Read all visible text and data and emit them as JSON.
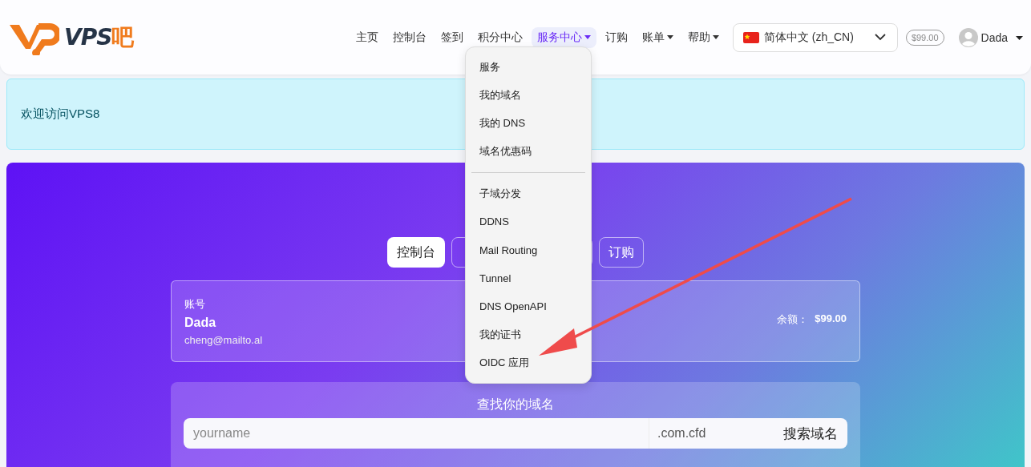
{
  "logo": {
    "text": "VPS",
    "accent": "吧"
  },
  "nav": [
    {
      "label": "主页",
      "selected": false,
      "dropdown": false
    },
    {
      "label": "控制台",
      "selected": false,
      "dropdown": false
    },
    {
      "label": "签到",
      "selected": false,
      "dropdown": false
    },
    {
      "label": "积分中心",
      "selected": false,
      "dropdown": false
    },
    {
      "label": "服务中心",
      "selected": true,
      "dropdown": true
    },
    {
      "label": "订购",
      "selected": false,
      "dropdown": false
    },
    {
      "label": "账单",
      "selected": false,
      "dropdown": true
    },
    {
      "label": "帮助",
      "selected": false,
      "dropdown": true
    }
  ],
  "language": {
    "value": "简体中文 (zh_CN)"
  },
  "balance_badge": "$99.00",
  "user": {
    "name": "Dada"
  },
  "alert": "欢迎访问VPS8",
  "dropdown_menu": [
    {
      "label": "服务",
      "kind": "item"
    },
    {
      "label": "我的域名",
      "kind": "item"
    },
    {
      "label": "我的 DNS",
      "kind": "item"
    },
    {
      "label": "域名优惠码",
      "kind": "item"
    },
    {
      "kind": "divider"
    },
    {
      "label": "子域分发",
      "kind": "item"
    },
    {
      "label": "DDNS",
      "kind": "item"
    },
    {
      "label": "Mail Routing",
      "kind": "item"
    },
    {
      "label": "Tunnel",
      "kind": "item"
    },
    {
      "label": "DNS OpenAPI",
      "kind": "item"
    },
    {
      "label": "我的证书",
      "kind": "item"
    },
    {
      "label": "OIDC 应用",
      "kind": "item"
    }
  ],
  "hero_tabs": [
    {
      "label": "控制台",
      "selected": true
    },
    {
      "selected": false
    },
    {
      "selected": false
    },
    {
      "label": "订购",
      "selected": false
    }
  ],
  "account": {
    "heading": "账号",
    "name": "Dada",
    "email": "cheng@mailto.al",
    "balance_label": "余额：",
    "balance": "$99.00"
  },
  "domain_search": {
    "title": "查找你的域名",
    "placeholder": "yourname",
    "suffix": ".com.cfd",
    "button": "搜索域名"
  }
}
